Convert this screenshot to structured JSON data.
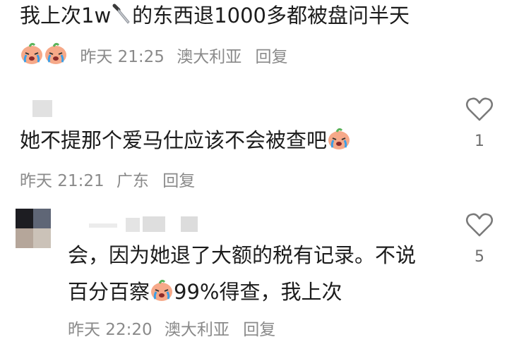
{
  "comments": [
    {
      "text_before": "我上次1w",
      "text_after": "的东西退1000多都被盘问半天",
      "meta": {
        "time": "昨天 21:25",
        "location": "澳大利亚",
        "reply": "回复"
      },
      "icons": [
        "knife-emoji",
        "crying-emoji",
        "crying-emoji"
      ]
    },
    {
      "text": "她不提那个爱马仕应该不会被查吧",
      "meta": {
        "time": "昨天 21:21",
        "location": "广东",
        "reply": "回复"
      },
      "likes": "1",
      "icons": [
        "crying-emoji",
        "heart-icon"
      ]
    },
    {
      "line1": "会，因为她退了大额的税有记录。不说",
      "line2_before": "百分百察",
      "line2_after": "99%得查，我上次",
      "meta": {
        "time": "昨天 22:20",
        "location": "澳大利亚",
        "reply": "回复"
      },
      "likes": "5",
      "icons": [
        "crying-emoji",
        "heart-icon"
      ]
    }
  ],
  "colors": {
    "text": "#1c1c1c",
    "meta": "#8a8a8a",
    "count": "#6f6f6f",
    "heart_stroke": "#7a7a7a"
  }
}
